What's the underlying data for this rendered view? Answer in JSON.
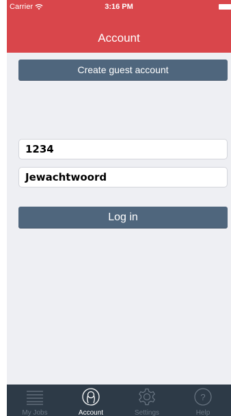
{
  "status_bar": {
    "carrier": "Carrier",
    "time": "3:16 PM"
  },
  "nav": {
    "title": "Account"
  },
  "actions": {
    "guest_label": "Create guest account",
    "login_label": "Log in"
  },
  "form": {
    "username_value": "1234",
    "password_value": "Jewachtwoord"
  },
  "tabs": [
    {
      "label": "My Jobs",
      "icon": "list-icon"
    },
    {
      "label": "Account",
      "icon": "user-icon"
    },
    {
      "label": "Settings",
      "icon": "gear-icon"
    },
    {
      "label": "Help",
      "icon": "help-icon"
    }
  ],
  "colors": {
    "header": "#d9464b",
    "button": "#4f667d",
    "tab_bar": "#2d3a47",
    "background": "#eeeff3"
  }
}
